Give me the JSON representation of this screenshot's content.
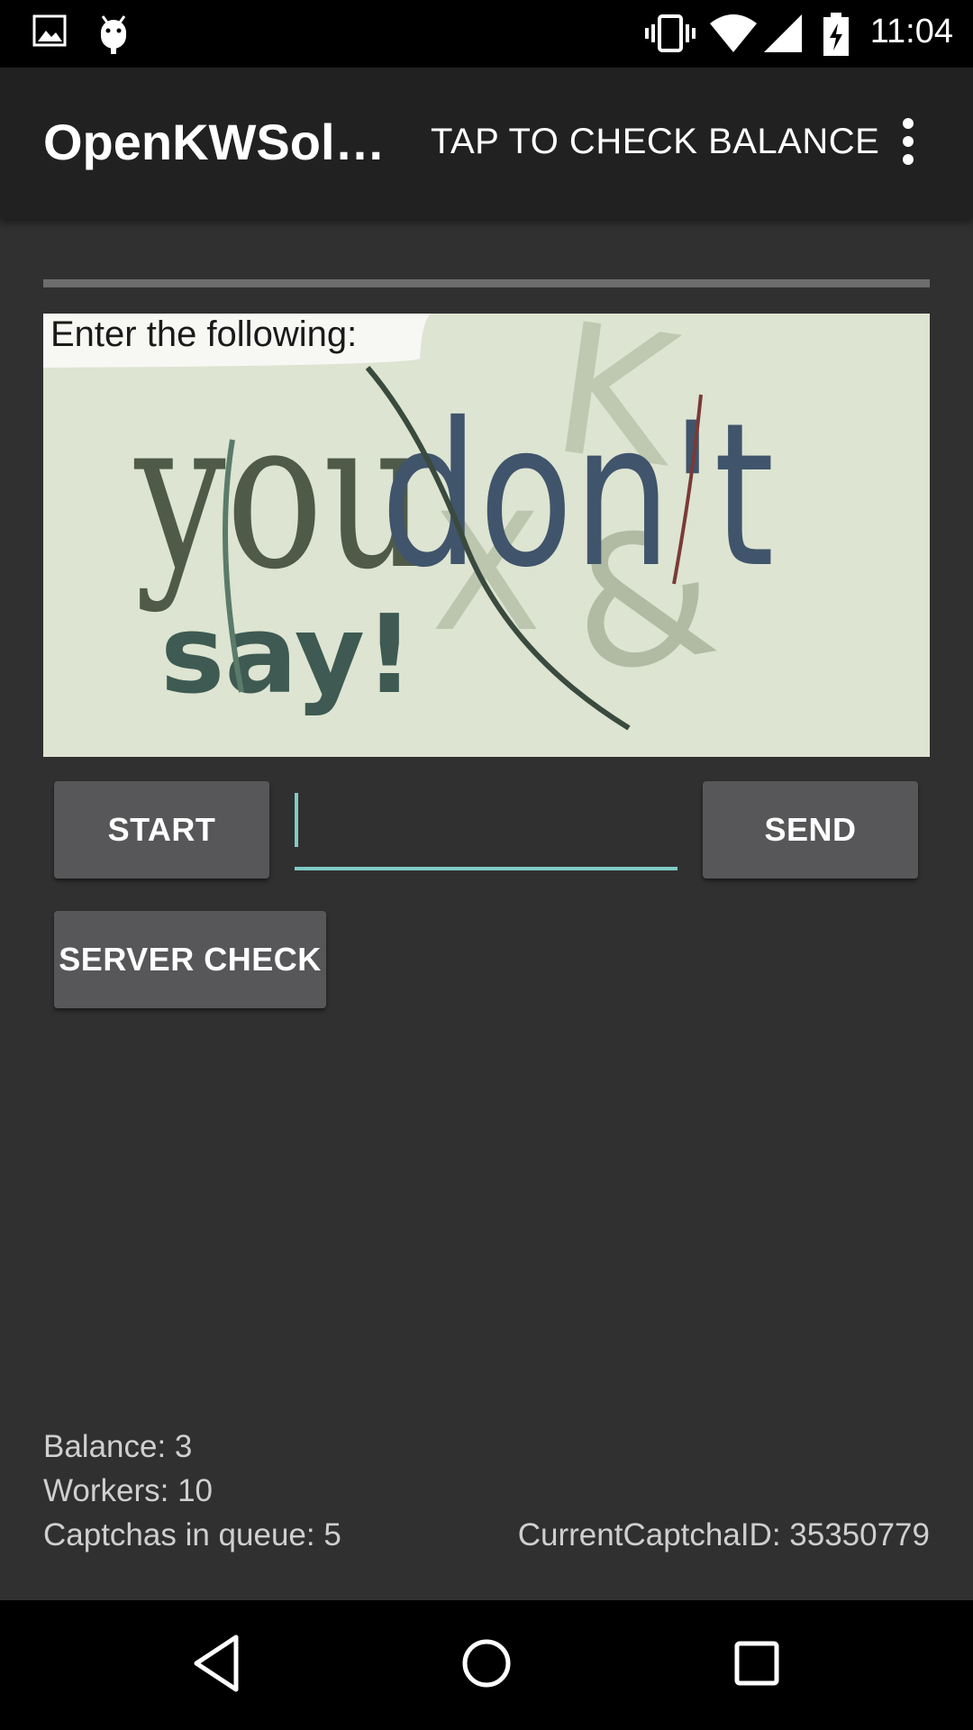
{
  "status_bar": {
    "time": "11:04",
    "left_icons": [
      "image-icon",
      "android-debug-icon"
    ],
    "right_icons": [
      "vibrate-icon",
      "wifi-icon",
      "signal-icon",
      "battery-charging-icon"
    ]
  },
  "app_bar": {
    "title": "OpenKWSol…",
    "action_label": "TAP TO CHECK BALANCE",
    "menu_icon": "overflow-menu-icon"
  },
  "captcha": {
    "header_text": "Enter the following:",
    "words": [
      "you",
      "don't",
      "say!"
    ],
    "background": "#dde4d1"
  },
  "controls": {
    "start_label": "START",
    "answer_value": "",
    "send_label": "SEND",
    "server_check_label": "SERVER CHECK"
  },
  "info": {
    "balance": "Balance: 3",
    "workers": "Workers: 10",
    "queue": "Captchas in queue: 5",
    "captcha_id": "CurrentCaptchaID: 35350779"
  },
  "nav_bar": {
    "icons": [
      "back-icon",
      "home-icon",
      "recents-icon"
    ]
  },
  "colors": {
    "background": "#303030",
    "app_bar": "#212121",
    "button": "#575759",
    "accent": "#80cbc4"
  }
}
